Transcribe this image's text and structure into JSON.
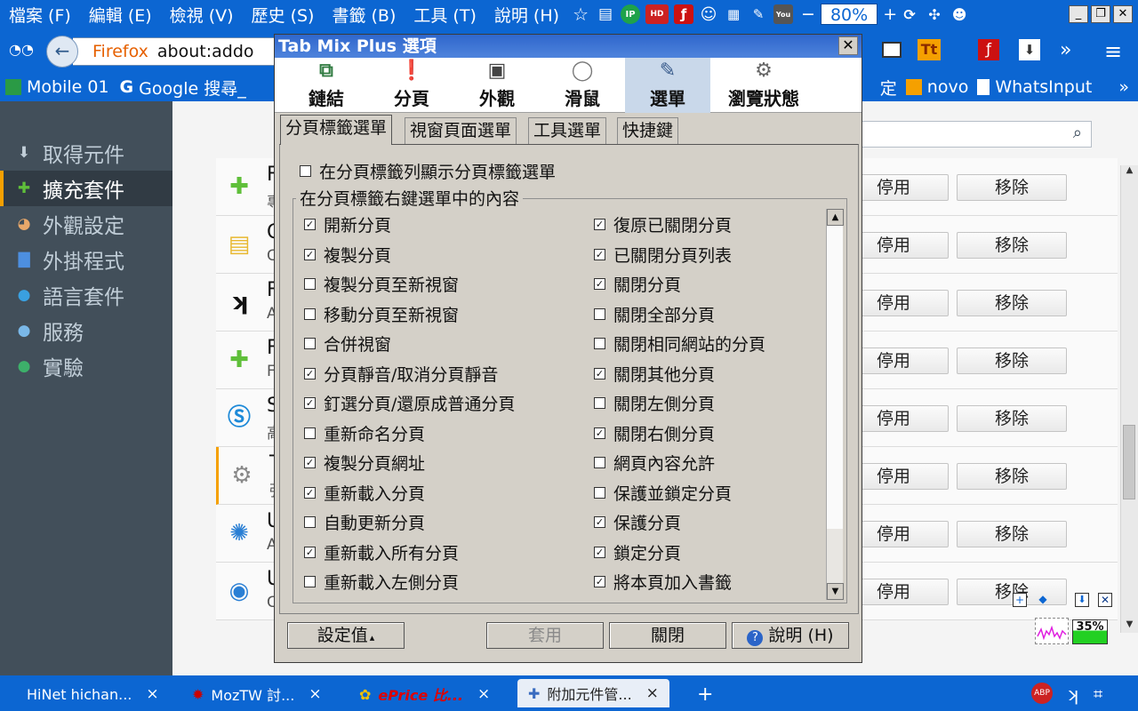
{
  "menubar": {
    "items": [
      "檔案 (F)",
      "編輯 (E)",
      "檢視 (V)",
      "歷史 (S)",
      "書籤 (B)",
      "工具 (T)",
      "說明 (H)"
    ],
    "zoom": "80%",
    "zoom_minus": "−",
    "zoom_plus": "+",
    "win_min": "_",
    "win_restore": "❐",
    "win_close": "✕"
  },
  "nav": {
    "back": "←",
    "identity": "Firefox",
    "url": "about:addo"
  },
  "bookmarks": {
    "left": [
      "Mobile 01",
      "Google 搜尋_"
    ],
    "right": [
      "定",
      "novo",
      "WhatsInput"
    ],
    "chevron": "»"
  },
  "sidebar": {
    "items": [
      {
        "label": "取得元件",
        "icon": "download-icon"
      },
      {
        "label": "擴充套件",
        "icon": "puzzle-icon"
      },
      {
        "label": "外觀設定",
        "icon": "palette-icon"
      },
      {
        "label": "外掛程式",
        "icon": "plugin-icon"
      },
      {
        "label": "語言套件",
        "icon": "globe-icon"
      },
      {
        "label": "服務",
        "icon": "chat-icon"
      },
      {
        "label": "實驗",
        "icon": "flask-icon"
      }
    ]
  },
  "addons": {
    "search_icon": "⌕",
    "disable_label": "停用",
    "remove_label": "移除",
    "rows": [
      {
        "name": "F",
        "desc": "專",
        "icon": "puzzle-icon"
      },
      {
        "name": "C",
        "desc": "C",
        "icon": "note-icon"
      },
      {
        "name": "F",
        "desc": "A",
        "icon": "k-logo-icon"
      },
      {
        "name": "F",
        "desc": "F",
        "icon": "puzzle-icon"
      },
      {
        "name": "S",
        "desc": "高",
        "icon": "s-logo-icon"
      },
      {
        "name": "T",
        "desc": "強",
        "icon": "gear-icon"
      },
      {
        "name": "U",
        "desc": "A",
        "icon": "compass-icon"
      },
      {
        "name": "U",
        "desc": "C",
        "icon": "network-icon"
      }
    ]
  },
  "dialog": {
    "title": "Tab Mix Plus 選項",
    "close": "✕",
    "toolbar": [
      "鏈結",
      "分頁",
      "外觀",
      "滑鼠",
      "選單",
      "瀏覽狀態"
    ],
    "tabs": [
      "分頁標籤選單",
      "視窗頁面選單",
      "工具選單",
      "快捷鍵"
    ],
    "top_option": {
      "label": "在分頁標籤列顯示分頁標籤選單",
      "checked": false
    },
    "group_label": "在分頁標籤右鍵選單中的內容",
    "left_items": [
      {
        "label": "開新分頁",
        "checked": true
      },
      {
        "label": "複製分頁",
        "checked": true
      },
      {
        "label": "複製分頁至新視窗",
        "checked": false
      },
      {
        "label": "移動分頁至新視窗",
        "checked": false
      },
      {
        "label": "合併視窗",
        "checked": false
      },
      {
        "label": "分頁靜音/取消分頁靜音",
        "checked": true
      },
      {
        "label": "釘選分頁/還原成普通分頁",
        "checked": true
      },
      {
        "label": "重新命名分頁",
        "checked": false
      },
      {
        "label": "複製分頁網址",
        "checked": true
      },
      {
        "label": "重新載入分頁",
        "checked": true
      },
      {
        "label": "自動更新分頁",
        "checked": false
      },
      {
        "label": "重新載入所有分頁",
        "checked": true
      },
      {
        "label": "重新載入左側分頁",
        "checked": false
      }
    ],
    "right_items": [
      {
        "label": "復原已關閉分頁",
        "checked": true
      },
      {
        "label": "已關閉分頁列表",
        "checked": true
      },
      {
        "label": "關閉分頁",
        "checked": true
      },
      {
        "label": "關閉全部分頁",
        "checked": false
      },
      {
        "label": "關閉相同網站的分頁",
        "checked": false
      },
      {
        "label": "關閉其他分頁",
        "checked": true
      },
      {
        "label": "關閉左側分頁",
        "checked": false
      },
      {
        "label": "關閉右側分頁",
        "checked": true
      },
      {
        "label": "網頁內容允許",
        "checked": false
      },
      {
        "label": "保護並鎖定分頁",
        "checked": false
      },
      {
        "label": "保護分頁",
        "checked": true
      },
      {
        "label": "鎖定分頁",
        "checked": true
      },
      {
        "label": "將本頁加入書籤",
        "checked": true
      }
    ],
    "buttons": {
      "settings": "設定值",
      "settings_arrow": "▴",
      "apply": "套用",
      "close": "關閉",
      "help": "說明 (H)"
    }
  },
  "tabbar": {
    "tabs": [
      "HiNet hichan...",
      "MozTW 討...",
      "ePrice 比...",
      "附加元件管..."
    ],
    "close": "×",
    "new_tab": "+"
  },
  "widget": {
    "percent": "35%"
  },
  "colors": {
    "accent": "#0c66d2",
    "sidebar_bg": "#424f5a",
    "selected_marker": "#f5a000",
    "dialog_title": "#2f67cc"
  }
}
